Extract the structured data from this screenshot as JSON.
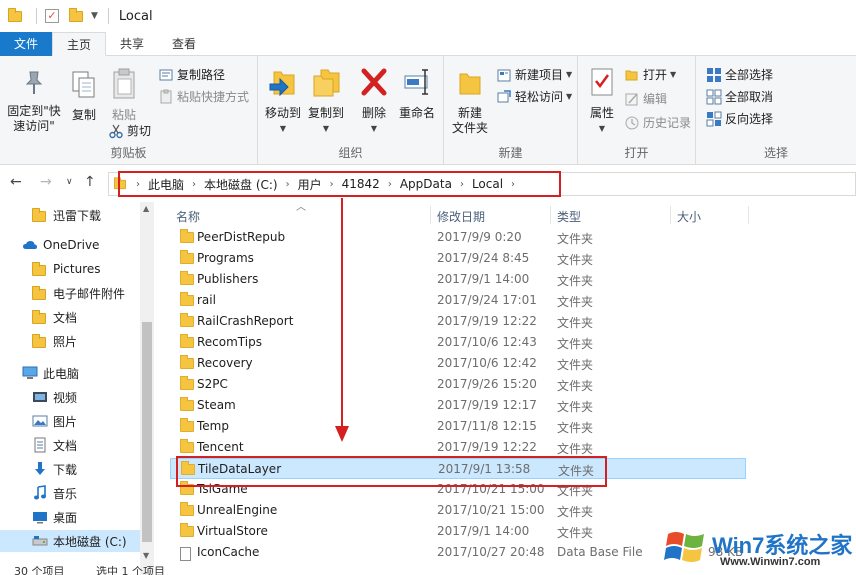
{
  "titlebar": {
    "title": "Local"
  },
  "tabs": [
    "文件",
    "主页",
    "共享",
    "查看"
  ],
  "ribbon": {
    "clipboard": {
      "pin": "固定到\"快速访问\"",
      "copy": "复制",
      "paste": "粘贴",
      "copy_path": "复制路径",
      "paste_shortcut": "粘贴快捷方式",
      "cut": "剪切",
      "label": "剪贴板"
    },
    "organize": {
      "move_to": "移动到",
      "copy_to": "复制到",
      "delete": "删除",
      "rename": "重命名",
      "label": "组织"
    },
    "new": {
      "new_folder": "新建\n文件夹",
      "new_item": "新建项目",
      "easy_access": "轻松访问",
      "label": "新建"
    },
    "open": {
      "properties": "属性",
      "open": "打开",
      "edit": "编辑",
      "history": "历史记录",
      "label": "打开"
    },
    "select": {
      "select_all": "全部选择",
      "select_none": "全部取消",
      "invert": "反向选择",
      "label": "选择"
    }
  },
  "address": {
    "crumbs": [
      "此电脑",
      "本地磁盘 (C:)",
      "用户",
      "41842",
      "AppData",
      "Local"
    ]
  },
  "sidebar": {
    "items": [
      {
        "label": "迅雷下载",
        "icon": "folder-icon"
      },
      {
        "label": "OneDrive",
        "icon": "cloud-icon"
      },
      {
        "label": "Pictures",
        "icon": "folder-icon"
      },
      {
        "label": "电子邮件附件",
        "icon": "folder-icon"
      },
      {
        "label": "文档",
        "icon": "folder-icon"
      },
      {
        "label": "照片",
        "icon": "folder-icon"
      },
      {
        "label": "此电脑",
        "icon": "computer-icon"
      },
      {
        "label": "视频",
        "icon": "video-icon"
      },
      {
        "label": "图片",
        "icon": "pictures-icon"
      },
      {
        "label": "文档",
        "icon": "documents-icon"
      },
      {
        "label": "下载",
        "icon": "download-icon"
      },
      {
        "label": "音乐",
        "icon": "music-icon"
      },
      {
        "label": "桌面",
        "icon": "desktop-icon"
      },
      {
        "label": "本地磁盘 (C:)",
        "icon": "drive-icon"
      }
    ]
  },
  "columns": {
    "name": "名称",
    "date": "修改日期",
    "type": "类型",
    "size": "大小"
  },
  "files": [
    {
      "name": "PeerDistRepub",
      "date": "2017/9/9 0:20",
      "type": "文件夹"
    },
    {
      "name": "Programs",
      "date": "2017/9/24 8:45",
      "type": "文件夹"
    },
    {
      "name": "Publishers",
      "date": "2017/9/1 14:00",
      "type": "文件夹"
    },
    {
      "name": "rail",
      "date": "2017/9/24 17:01",
      "type": "文件夹"
    },
    {
      "name": "RailCrashReport",
      "date": "2017/9/19 12:22",
      "type": "文件夹"
    },
    {
      "name": "RecomTips",
      "date": "2017/10/6 12:43",
      "type": "文件夹"
    },
    {
      "name": "Recovery",
      "date": "2017/10/6 12:42",
      "type": "文件夹"
    },
    {
      "name": "S2PC",
      "date": "2017/9/26 15:20",
      "type": "文件夹"
    },
    {
      "name": "Steam",
      "date": "2017/9/19 12:17",
      "type": "文件夹"
    },
    {
      "name": "Temp",
      "date": "2017/11/8 12:15",
      "type": "文件夹"
    },
    {
      "name": "Tencent",
      "date": "2017/9/19 12:22",
      "type": "文件夹"
    },
    {
      "name": "TileDataLayer",
      "date": "2017/9/1 13:58",
      "type": "文件夹"
    },
    {
      "name": "TslGame",
      "date": "2017/10/21 15:00",
      "type": "文件夹"
    },
    {
      "name": "UnrealEngine",
      "date": "2017/10/21 15:00",
      "type": "文件夹"
    },
    {
      "name": "VirtualStore",
      "date": "2017/9/1 14:00",
      "type": "文件夹"
    },
    {
      "name": "IconCache",
      "date": "2017/10/27 20:48",
      "type": "Data Base File",
      "size": "98 KB"
    }
  ],
  "status": {
    "count": "30 个项目",
    "selected": "选中 1 个项目"
  },
  "watermark": {
    "brand": "Win7系统之家",
    "url": "Www.Winwin7.com"
  },
  "colors": {
    "accent": "#1979ca",
    "highlight_box": "#d42020",
    "selected_row": "#cce8ff",
    "folder": "#f5c542"
  }
}
